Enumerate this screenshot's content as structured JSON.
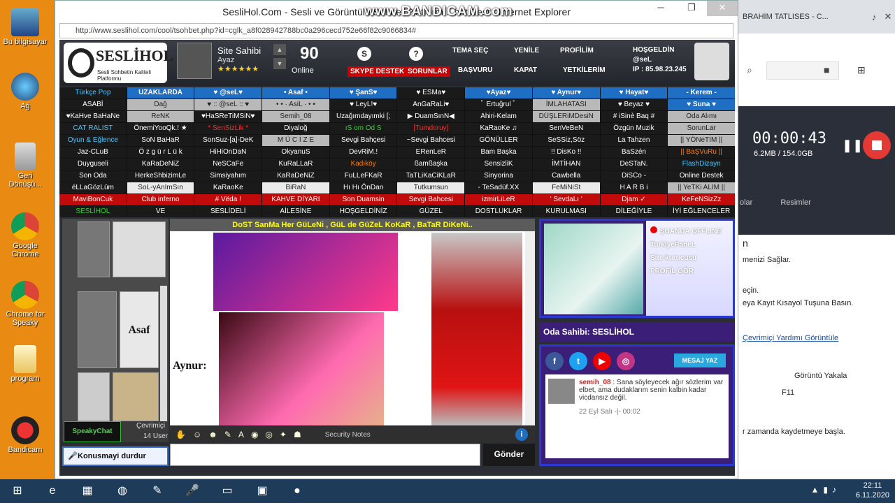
{
  "desktop": {
    "icons": [
      "Bu bilgisayar",
      "Ağ",
      "Geri Dönüşü...",
      "Google Chrome",
      "Chrome for Speaky",
      "program",
      "Bandicam"
    ]
  },
  "bandicam": {
    "tab_title": "BRAHİM TATLISES - C...",
    "rec_time": "00:00:43",
    "rec_size": "6.2MB / 154.0GB",
    "menu": [
      "olar",
      "Resimler"
    ],
    "content_lines": [
      "n",
      "menizi Sağlar.",
      "eçin.",
      "eya Kayıt Kısayol Tuşuna Basın.",
      "Çevrimiçi Yardımı Görüntüle",
      "Görüntü Yakala",
      "F11",
      "r zamanda kaydetmeye başla."
    ]
  },
  "ie": {
    "title": "SesliHol.Com - Sesli ve Görüntülü Sohbet Platform... hat,Sesl - Internet Explorer",
    "watermark": "www.BANDICAM.com",
    "address": "http://www.seslihol.com/cool/tsohbet.php?id=cglk_a8f028942788bc0a296cecd752e66f82c9066834#",
    "win_controls": [
      "─",
      "❐",
      "✕"
    ]
  },
  "site": {
    "logo_title": "SESLİHOL",
    "logo_sub": "Sesli Sohbetin Kaliteli Platformu",
    "owner_title": "Site Sahibi",
    "owner_name": "Ayaz",
    "stars": "★★★★★★",
    "online_count": "90",
    "online_label": "Online",
    "skype": "SKYPE DESTEK",
    "sorunlar": "SORUNLAR",
    "tema": "TEMA SEÇ",
    "basvuru": "BAŞVURU",
    "yenile": "YENİLE",
    "kapat": "KAPAT",
    "profilim": "PROFİLİM",
    "yetkilerim": "YETKİLERİM",
    "welcome": "HOŞGELDİN",
    "welcome_user": "@seL",
    "ip": "IP : 85.98.23.245",
    "rooms": [
      [
        "Türkçe Pop",
        "UZAKLARDA",
        "♥ @seL♥",
        "• Asaf •",
        "♥ ŞanS♥",
        "♥ ESMa♥",
        "♥Ayaz♥",
        "♥ Aynur♥",
        "♥ Hayat♥",
        "- Kerem -"
      ],
      [
        "ASABİ",
        "Dağ",
        "♥ :: @seL :: ♥",
        "• • · AsiL · • •",
        "♥ LeyL!♥",
        "AnGaRaLi♥",
        "ﾟ Ertuğrul ﾟ",
        "İMLAHATASI",
        "♥ Beyaz ♥",
        "♥ Suna ♥"
      ],
      [
        "♥KaHve BaHaNe",
        "ReNK",
        "♥HaSReTiMSiN♥",
        "Semih_08",
        "Uzağımdayımki [;",
        "▶ DuamSınN◀",
        "Ahiri-Kelam",
        "DÜŞLERiMDesiN",
        "# iSinè Baq #",
        "Oda Alımı"
      ],
      [
        "CAT RALIST",
        "ÖnemiYooQk.! ★",
        "* SenSizLik *",
        "Diyaloğ",
        "ıS om Od S",
        "[Tumdoruy]",
        "KaRaoKe ♫",
        "SenVeBeN",
        "Özgün Muzik",
        "SorunLar"
      ],
      [
        "Oyun & Eğlence",
        "SoN BaHaR",
        "SonSuz-[a]-DeK",
        "M Ü C İ Z E",
        "Sevgi Bahçesi",
        "~Sevgi Bahcesi",
        "GÖNÜLLER",
        "SeSSiz,Söz",
        "La Tahzen",
        "|| YÖNeTİM ||"
      ],
      [
        "Jaz-CLuB",
        "Ö z g ü r L ü k",
        "HiHiOnDaN",
        "OkyanuS",
        "DevRiM.!",
        "ERenLeR",
        "Bam Başka",
        "!! DisKo !!",
        "BaSzén",
        "|| BaŞVuRu ||"
      ],
      [
        "Duyguseli",
        "KaRaDeNiZ",
        "NeSCaFe",
        "KuRaLLaR",
        "Kadıköy",
        "ßamßaşka",
        "SensizliK",
        "İMTİHAN",
        "DeSTaN.",
        "FlashDizayn"
      ],
      [
        "Son Oda",
        "HerkeShbizimLe",
        "Simsiyahım",
        "KaRaDeNiZ",
        "FuLLeFKaR",
        "TaTLiKaCiKLaR",
        "Sinyorina",
        "Cawbella",
        "DiSCo -",
        "Online Destek"
      ],
      [
        "éLLaGözLüm",
        "SoL-yAnImSın",
        "KaRaoKe",
        "BiRaN",
        "Hı Hı ÖnDan",
        "Tutkumsun",
        "- TeSadüf.XX",
        "FeMiNiSt",
        "H A R B i",
        "|| YeTKi ALIM ||"
      ],
      [
        "MaviBonCuk",
        "Club inferno",
        "# Vëda !",
        "KAHVE DİYARI",
        "Son Duamsin",
        "Sevgi Bahcesi",
        "izmirLiLeR",
        "' SevdaLı '",
        "Djam ✓",
        "KeFeNSizZz"
      ],
      [
        "SESLİHOL",
        "VE",
        "SESLİDELİ",
        "AİLESİNE",
        "HOŞGELDİNİZ",
        "GÜZEL",
        "DOSTLUKLAR",
        "KURULMASI",
        "DİLEĞİYLE",
        "İYİ EĞLENCELER"
      ]
    ],
    "speaky_logo": "SpeakyChat",
    "cevrimici": "Çevrimiçi",
    "user_count": "14 User",
    "stop_button": "Konusmayi durdur",
    "chat_header": "DoST SanMa Her GüLeNi , GüL de GüZeL KoKaR , BaTaR DiKeNi..",
    "speaker": "Aynur:",
    "user_tag": "Asaf",
    "security_notes": "Security Notes",
    "send_button": "Gönder",
    "profile_status": "ŞUANDA OFFLINE",
    "profile_lines": [
      "TurkiyePaneL",
      "Site kurucusu",
      "PROFİL GÖR"
    ],
    "room_owner": "Oda Sahibi: SESLİHOL",
    "mesaj_yaz": "MESAJ YAZ",
    "msg_author": "semih_08",
    "msg_text": ": Sana söyleyecek ağır sözlerim var elbet, ama dudaklarım senin kalbin kadar vicdansız değil.",
    "msg_time": "22 Eyl Salı -|- 00:02"
  },
  "taskbar": {
    "time": "22:11",
    "date": "6.11.2020"
  }
}
